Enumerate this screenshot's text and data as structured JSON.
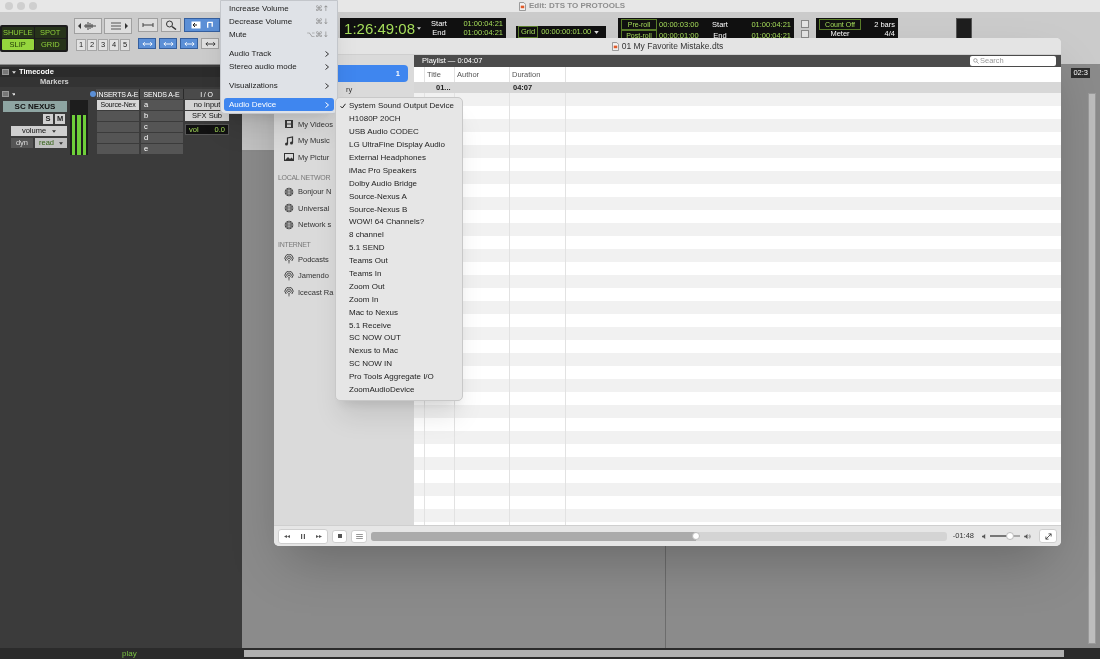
{
  "protools": {
    "title": "Edit: DTS TO PROTOOLS",
    "edit_modes": [
      {
        "label": "SHUFLE",
        "selected": false
      },
      {
        "label": "SPOT",
        "selected": false
      },
      {
        "label": "SLIP",
        "selected": true
      },
      {
        "label": "GRID",
        "selected": false
      }
    ],
    "zoom_presets": [
      "1",
      "2",
      "3",
      "4",
      "5"
    ],
    "main_counter": "1:26:49:08",
    "selection": [
      {
        "label": "Start",
        "value": "01:00:04:21"
      },
      {
        "label": "End",
        "value": "01:00:04:21"
      }
    ],
    "grid": {
      "label": "Grid",
      "value": "00:00:00:01.00"
    },
    "roll": [
      {
        "label": "Pre-roll",
        "value": "00:00:03:00",
        "selection_label": "Start",
        "selection_value": "01:00:04:21"
      },
      {
        "label": "Post-roll",
        "value": "00:00:01:00",
        "selection_label": "End",
        "selection_value": "01:00:04:21"
      }
    ],
    "count_off": {
      "label": "Count Off",
      "value": "2 bars"
    },
    "meter": {
      "label": "Meter",
      "value": "4/4"
    },
    "rulers": [
      "Timecode",
      "Markers"
    ],
    "mixer_columns": [
      "INSERTS A-E",
      "SENDS A-E",
      "I / O"
    ],
    "track": {
      "name": "SC NEXUS",
      "solo": "S",
      "mute": "M",
      "view": "volume",
      "automation_label": "dyn",
      "automation_mode": "read",
      "meter": {
        "level": 0.72
      },
      "inserts": [
        "Source-Nex"
      ],
      "sends": [
        "a",
        "b",
        "c",
        "d",
        "e"
      ],
      "input": "no input",
      "output": "SFX Sub",
      "volume_label": "vol",
      "volume": "0.0"
    },
    "ruler_readout": "02:3",
    "status": "play"
  },
  "player": {
    "title": "01 My Favorite Mistake.dts",
    "sidebar": [
      {
        "items": [
          {
            "badge": "1",
            "selected": true
          },
          {
            "label": "ry",
            "selected": false
          }
        ]
      },
      {
        "items": [
          {
            "kind": "videos",
            "label": "My Videos",
            "selected": false
          },
          {
            "kind": "music",
            "label": "My Music",
            "selected": false
          },
          {
            "kind": "pictures",
            "label": "My Pictur",
            "selected": false
          }
        ]
      },
      {
        "heading": "LOCAL NETWOR",
        "items": [
          {
            "kind": "network",
            "label": "Bonjour N",
            "selected": false
          },
          {
            "kind": "network",
            "label": "Universal",
            "selected": false
          },
          {
            "kind": "network",
            "label": "Network s",
            "selected": false
          }
        ]
      },
      {
        "heading": "INTERNET",
        "items": [
          {
            "kind": "stream",
            "label": "Podcasts",
            "selected": false
          },
          {
            "kind": "stream",
            "label": "Jamendo",
            "selected": false
          },
          {
            "kind": "stream",
            "label": "Icecast Ra",
            "selected": false
          }
        ]
      }
    ],
    "playlist_title": "Playlist — 0:04:07",
    "search": {
      "placeholder": "Search"
    },
    "columns": [
      "Title",
      "Author",
      "Duration"
    ],
    "rows": [
      {
        "title": "01...",
        "duration": "04:07",
        "selected": true
      }
    ],
    "playing": true,
    "progress": {
      "level": 0.565
    },
    "remaining": "-01:48",
    "volume": {
      "level": 0.67
    }
  },
  "menu": {
    "items": [
      {
        "kind": "command",
        "label": "Increase Volume",
        "shortcut": "⌘↑",
        "highlighted": false
      },
      {
        "kind": "command",
        "label": "Decrease Volume",
        "shortcut": "⌘↓",
        "highlighted": false
      },
      {
        "kind": "command",
        "label": "Mute",
        "shortcut": "⌥⌘↓",
        "highlighted": false
      },
      {
        "kind": "separator"
      },
      {
        "kind": "submenu",
        "label": "Audio Track",
        "highlighted": false
      },
      {
        "kind": "submenu",
        "label": "Stereo audio mode",
        "highlighted": false
      },
      {
        "kind": "separator"
      },
      {
        "kind": "submenu",
        "label": "Visualizations",
        "highlighted": false
      },
      {
        "kind": "separator"
      },
      {
        "kind": "submenu",
        "label": "Audio Device",
        "highlighted": true
      }
    ],
    "submenu": [
      {
        "label": "System Sound Output Device",
        "checked": true
      },
      {
        "label": "H1080P 20CH",
        "checked": false
      },
      {
        "label": "USB Audio CODEC",
        "checked": false
      },
      {
        "label": "LG UltraFine Display Audio",
        "checked": false
      },
      {
        "label": "External Headphones",
        "checked": false
      },
      {
        "label": "iMac Pro Speakers",
        "checked": false
      },
      {
        "label": "Dolby Audio Bridge",
        "checked": false
      },
      {
        "label": "Source-Nexus A",
        "checked": false
      },
      {
        "label": "Source-Nexus B",
        "checked": false
      },
      {
        "label": "WOW! 64 Channels?",
        "checked": false
      },
      {
        "label": "8 channel",
        "checked": false
      },
      {
        "label": "5.1 SEND",
        "checked": false
      },
      {
        "label": "Teams Out",
        "checked": false
      },
      {
        "label": "Teams In",
        "checked": false
      },
      {
        "label": "Zoom Out",
        "checked": false
      },
      {
        "label": "Zoom In",
        "checked": false
      },
      {
        "label": "Mac to Nexus",
        "checked": false
      },
      {
        "label": "5.1 Receive",
        "checked": false
      },
      {
        "label": "SC NOW OUT",
        "checked": false
      },
      {
        "label": "Nexus to Mac",
        "checked": false
      },
      {
        "label": "SC NOW IN",
        "checked": false
      },
      {
        "label": "Pro Tools Aggregate I/O",
        "checked": false
      },
      {
        "label": "ZoomAudioDevice",
        "checked": false
      }
    ]
  }
}
